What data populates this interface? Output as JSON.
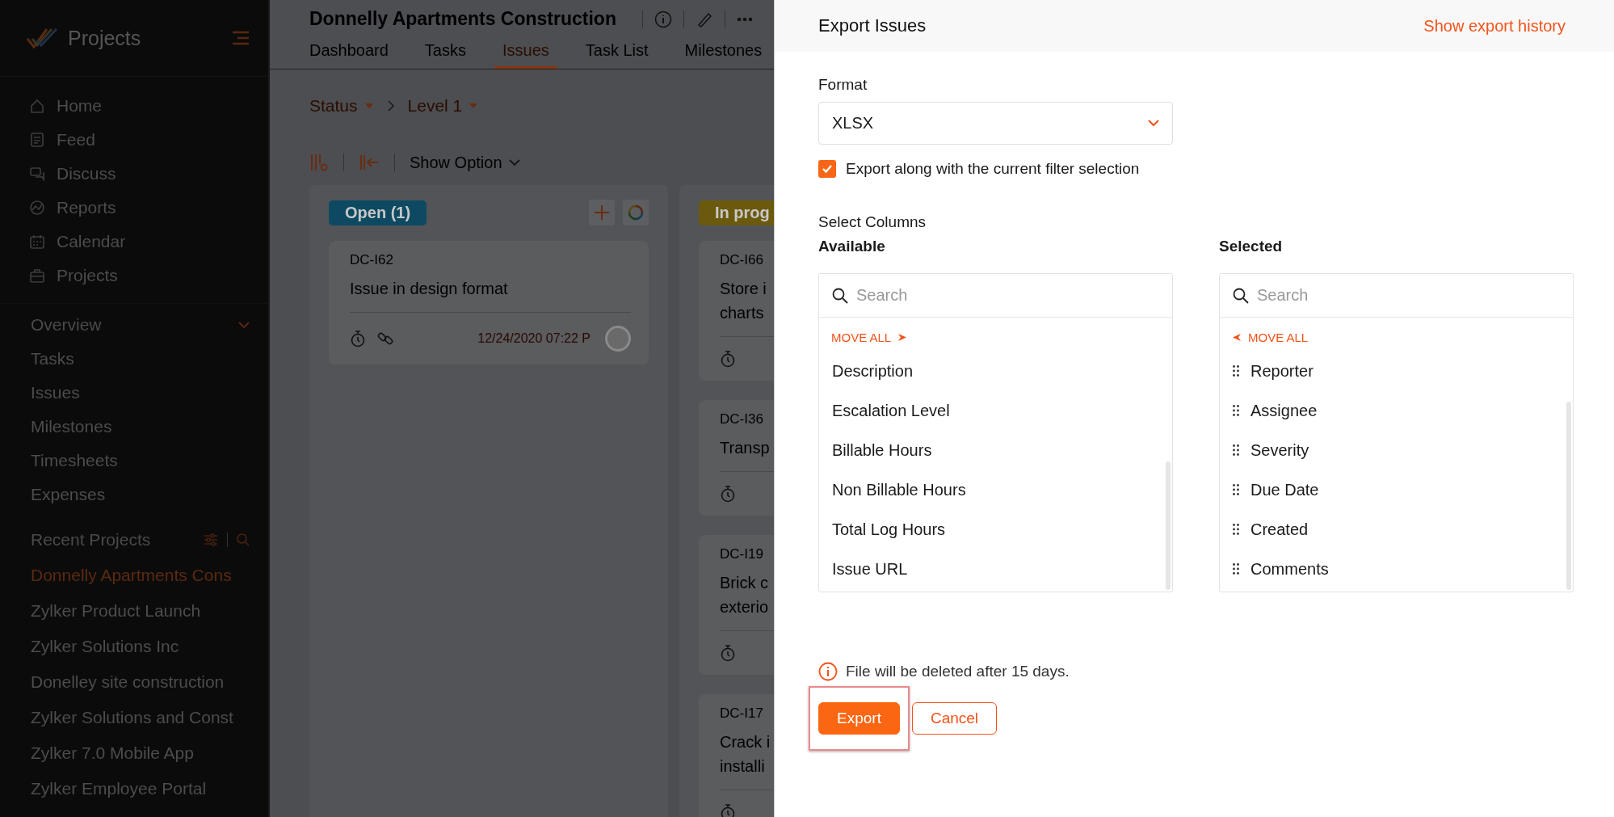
{
  "sidebar": {
    "app_title": "Projects",
    "nav": [
      {
        "label": "Home"
      },
      {
        "label": "Feed"
      },
      {
        "label": "Discuss"
      },
      {
        "label": "Reports"
      },
      {
        "label": "Calendar"
      },
      {
        "label": "Projects"
      }
    ],
    "overview": {
      "label": "Overview",
      "expanded": true,
      "items": [
        "Tasks",
        "Issues",
        "Milestones",
        "Timesheets",
        "Expenses"
      ]
    },
    "recent": {
      "label": "Recent Projects",
      "projects": [
        {
          "label": "Donnelly Apartments Cons",
          "selected": true
        },
        {
          "label": "Zylker Product Launch",
          "selected": false
        },
        {
          "label": "Zylker Solutions Inc",
          "selected": false
        },
        {
          "label": "Donelley site construction",
          "selected": false
        },
        {
          "label": "Zylker Solutions and Const",
          "selected": false
        },
        {
          "label": "Zylker 7.0 Mobile App",
          "selected": false
        },
        {
          "label": "Zylker Employee Portal",
          "selected": false
        }
      ]
    }
  },
  "main": {
    "title": "Donnelly Apartments Construction",
    "tabs": [
      {
        "label": "Dashboard",
        "selected": false
      },
      {
        "label": "Tasks",
        "selected": false
      },
      {
        "label": "Issues",
        "selected": true
      },
      {
        "label": "Task List",
        "selected": false
      },
      {
        "label": "Milestones",
        "selected": false
      }
    ],
    "breadcrumb": [
      "Status",
      "Level 1"
    ],
    "show_option": "Show Option",
    "columns": [
      {
        "title": "Open (1)",
        "color": "#0d4a62",
        "actions": true,
        "cards": [
          {
            "id": "DC-I62",
            "lines": [
              "Issue in design format"
            ],
            "has_link": true,
            "due": "12/24/2020 07:22 P"
          }
        ]
      },
      {
        "title": "In prog",
        "color": "#6b5a0e",
        "cards": [
          {
            "id": "DC-I66",
            "lines": [
              "Store i",
              "charts"
            ],
            "has_link": false
          },
          {
            "id": "DC-I36",
            "lines": [
              "Transp"
            ],
            "has_link": false
          },
          {
            "id": "DC-I19",
            "lines": [
              "Brick c",
              "exterio"
            ],
            "has_link": false
          },
          {
            "id": "DC-I17",
            "lines": [
              "Crack i",
              "installi"
            ],
            "has_link": false
          }
        ]
      }
    ]
  },
  "export_panel": {
    "title": "Export Issues",
    "history_link": "Show export history",
    "format_label": "Format",
    "format_value": "XLSX",
    "filter_checked": true,
    "filter_label": "Export along with the current filter selection",
    "select_columns_label": "Select Columns",
    "available": {
      "heading": "Available",
      "placeholder": "Search",
      "move_all": "MOVE ALL",
      "items": [
        "Description",
        "Escalation Level",
        "Billable Hours",
        "Non Billable Hours",
        "Total Log Hours",
        "Issue URL"
      ]
    },
    "selected": {
      "heading": "Selected",
      "placeholder": "Search",
      "move_all": "MOVE ALL",
      "items": [
        "Reporter",
        "Assignee",
        "Severity",
        "Due Date",
        "Created",
        "Comments"
      ]
    },
    "note": "File will be deleted after 15 days.",
    "buttons": [
      {
        "label": "Export",
        "kind": "primary",
        "highlighted": true
      },
      {
        "label": "Cancel",
        "kind": "secondary",
        "highlighted": false
      }
    ]
  }
}
